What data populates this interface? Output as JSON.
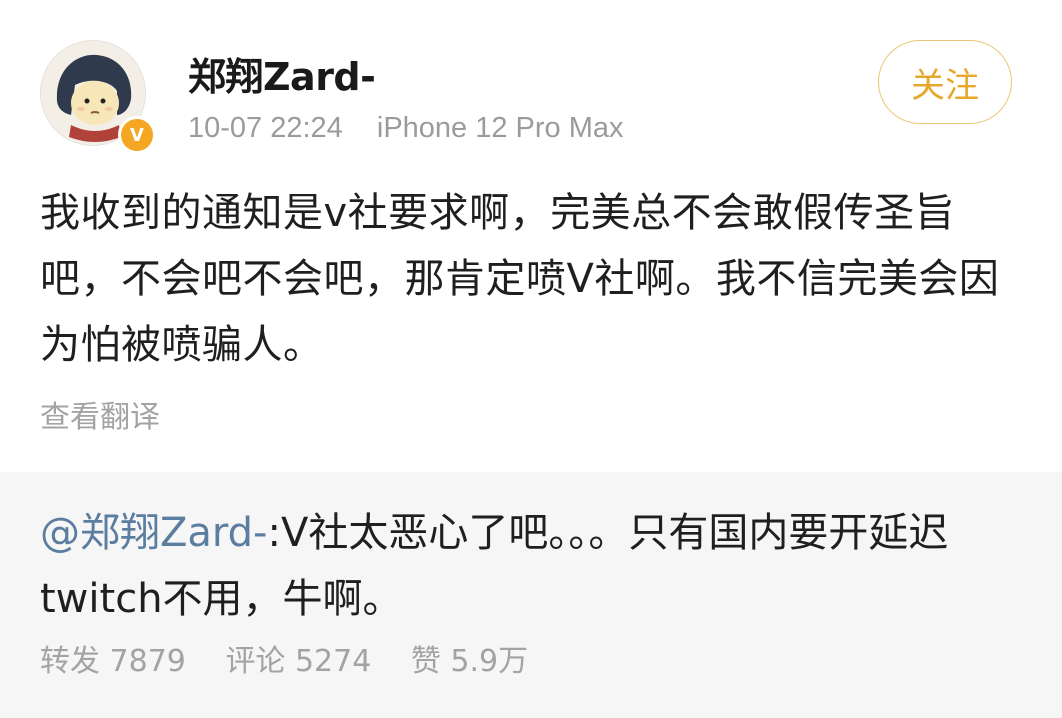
{
  "user": {
    "name": "郑翔Zard-",
    "verified_mark": "V",
    "date": "10-07 22:24",
    "device": "iPhone 12 Pro Max"
  },
  "actions": {
    "follow_label": "关注"
  },
  "post": {
    "text": "我收到的通知是v社要求啊，完美总不会敢假传圣旨吧，不会吧不会吧，那肯定喷V社啊。我不信完美会因为怕被喷骗人。",
    "translate_label": "查看翻译"
  },
  "repost": {
    "mention": "@郑翔Zard-",
    "text": ":V社太恶心了吧。。。只有国内要开延迟twitch不用，牛啊。",
    "stats": {
      "repost": "转发 7879",
      "comment": "评论 5274",
      "like": "赞 5.9万"
    }
  },
  "colors": {
    "accent_gold": "#e5a82a",
    "mention_blue": "#5a7da0",
    "muted_gray": "#9b9b9b",
    "repost_bg": "#f6f6f6"
  },
  "icons": {
    "avatar": "cartoon-avatar",
    "badge": "verified-badge-icon"
  }
}
